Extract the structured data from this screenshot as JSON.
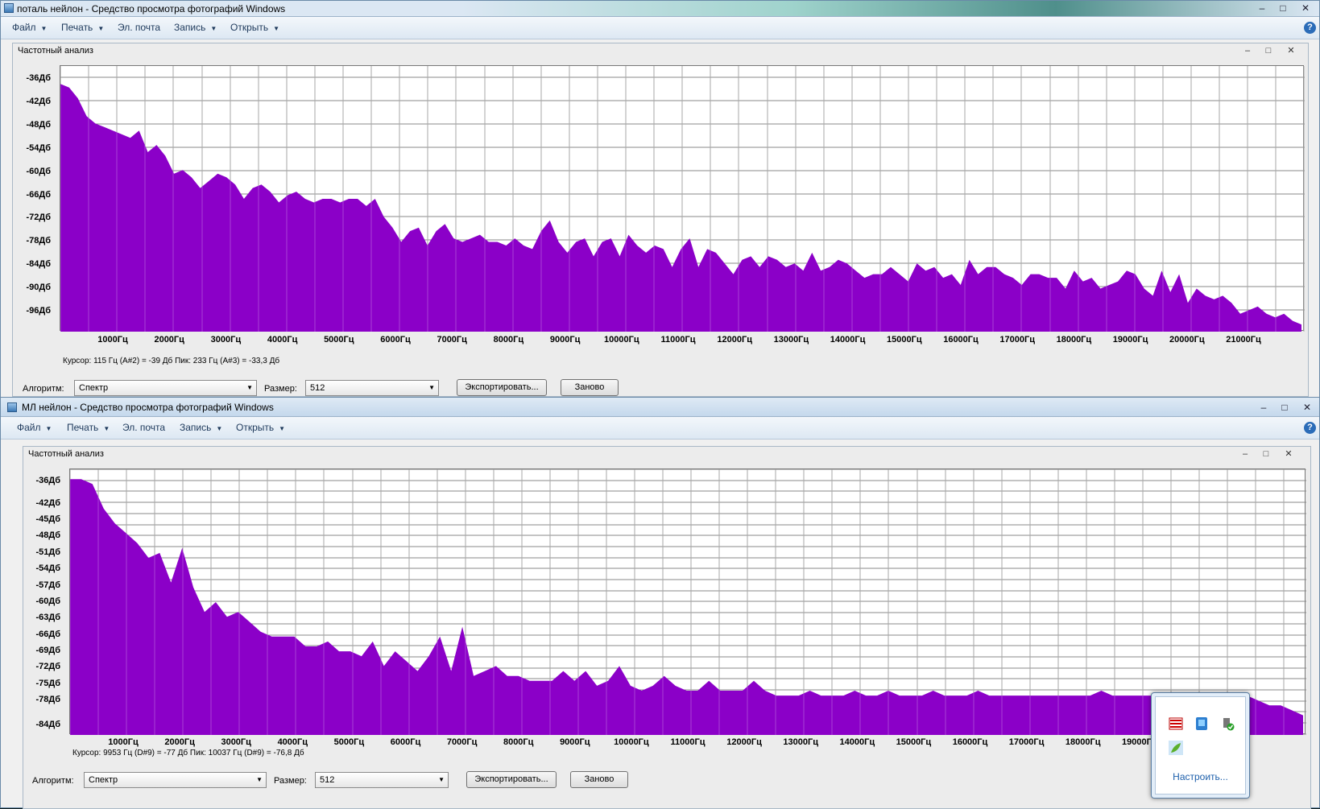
{
  "window1": {
    "title": "поталь нейлон - Средство просмотра фотографий Windows",
    "menu": [
      "Файл",
      "Печать",
      "Эл. почта",
      "Запись",
      "Открыть"
    ],
    "inner_title": "Частотный анализ",
    "ylabels": [
      "-36Дб",
      "-42Дб",
      "-48Дб",
      "-54Дб",
      "-60Дб",
      "-66Дб",
      "-72Дб",
      "-78Дб",
      "-84Дб",
      "-90Дб",
      "-96Дб"
    ],
    "xlabels": [
      "1000Гц",
      "2000Гц",
      "3000Гц",
      "4000Гц",
      "5000Гц",
      "6000Гц",
      "7000Гц",
      "8000Гц",
      "9000Гц",
      "10000Гц",
      "11000Гц",
      "12000Гц",
      "13000Гц",
      "14000Гц",
      "15000Гц",
      "16000Гц",
      "17000Гц",
      "18000Гц",
      "19000Гц",
      "20000Гц",
      "21000Гц"
    ],
    "status": "Курсор: 115 Гц (A#2) = -39 Дб    Пик: 233 Гц (A#3) = -33,3 Дб",
    "algorithm_label": "Алгоритм:",
    "algorithm_value": "Спектр",
    "size_label": "Размер:",
    "size_value": "512",
    "export_button": "Экспортировать...",
    "reset_button": "Заново"
  },
  "window2": {
    "title": "МЛ нейлон - Средство просмотра фотографий Windows",
    "menu": [
      "Файл",
      "Печать",
      "Эл. почта",
      "Запись",
      "Открыть"
    ],
    "inner_title": "Частотный анализ",
    "ylabels": [
      "-36Дб",
      "-42Дб",
      "-45Дб",
      "-48Дб",
      "-51Дб",
      "-54Дб",
      "-57Дб",
      "-60Дб",
      "-63Дб",
      "-66Дб",
      "-69Дб",
      "-72Дб",
      "-75Дб",
      "-78Дб",
      "-84Дб"
    ],
    "xlabels": [
      "1000Гц",
      "2000Гц",
      "3000Гц",
      "4000Гц",
      "5000Гц",
      "6000Гц",
      "7000Гц",
      "8000Гц",
      "9000Гц",
      "10000Гц",
      "11000Гц",
      "12000Гц",
      "13000Гц",
      "14000Гц",
      "15000Гц",
      "16000Гц",
      "17000Гц",
      "18000Гц",
      "19000Гц"
    ],
    "status": "Курсор: 9953 Гц (D#9) = -77 Дб    Пик: 10037 Гц (D#9) = -76,8 Дб",
    "algorithm_label": "Алгоритм:",
    "algorithm_value": "Спектр",
    "size_label": "Размер:",
    "size_value": "512",
    "export_button": "Экспортировать...",
    "reset_button": "Заново"
  },
  "tray": {
    "customize_link": "Настроить...",
    "icons": [
      "flag-icon",
      "network-icon",
      "usb-safe-remove-icon",
      "leaf-icon"
    ]
  },
  "colors": {
    "spectrum_fill": "#8b00c8",
    "grid": "#8a8a8a"
  },
  "spectrum1_db": [
    -35,
    -36,
    -39,
    -44,
    -46,
    -47,
    -48,
    -49,
    -50,
    -48,
    -54,
    -52,
    -55,
    -60,
    -59,
    -61,
    -64,
    -62,
    -60,
    -61,
    -63,
    -67,
    -64,
    -63,
    -65,
    -68,
    -66,
    -65,
    -67,
    -68,
    -67,
    -67,
    -68,
    -67,
    -67,
    -69,
    -67,
    -72,
    -75,
    -79,
    -76,
    -75,
    -80,
    -76,
    -74,
    -78,
    -79,
    -78,
    -77,
    -79,
    -79,
    -80,
    -78,
    -80,
    -81,
    -76,
    -73,
    -79,
    -82,
    -79,
    -78,
    -83,
    -79,
    -78,
    -83,
    -77,
    -80,
    -82,
    -80,
    -81,
    -86,
    -81,
    -78,
    -86,
    -81,
    -82,
    -85,
    -88,
    -84,
    -83,
    -86,
    -83,
    -84,
    -86,
    -85,
    -87,
    -82,
    -87,
    -86,
    -84,
    -85,
    -87,
    -89,
    -88,
    -88,
    -86,
    -88,
    -90,
    -85,
    -87,
    -86,
    -89,
    -88,
    -91,
    -84,
    -88,
    -86,
    -86,
    -88,
    -89,
    -91,
    -88,
    -88,
    -89,
    -89,
    -92,
    -87,
    -90,
    -89,
    -92,
    -91,
    -90,
    -87,
    -88,
    -92,
    -94,
    -87,
    -93,
    -88,
    -96,
    -92,
    -94,
    -95,
    -94,
    -96,
    -99,
    -98,
    -97,
    -99,
    -100,
    -99,
    -101,
    -102
  ],
  "spectrum2_db": [
    -36,
    -36,
    -37,
    -42,
    -45,
    -47,
    -49,
    -52,
    -51,
    -57,
    -50,
    -58,
    -63,
    -61,
    -64,
    -63,
    -65,
    -67,
    -68,
    -68,
    -68,
    -70,
    -70,
    -69,
    -71,
    -71,
    -72,
    -69,
    -74,
    -71,
    -73,
    -75,
    -72,
    -68,
    -75,
    -66,
    -76,
    -75,
    -74,
    -76,
    -76,
    -77,
    -77,
    -77,
    -75,
    -77,
    -75,
    -78,
    -77,
    -74,
    -78,
    -79,
    -78,
    -76,
    -78,
    -79,
    -79,
    -77,
    -79,
    -79,
    -79,
    -77,
    -79,
    -80,
    -80,
    -80,
    -79,
    -80,
    -80,
    -80,
    -79,
    -80,
    -80,
    -79,
    -80,
    -80,
    -80,
    -79,
    -80,
    -80,
    -80,
    -79,
    -80,
    -80,
    -80,
    -80,
    -80,
    -80,
    -80,
    -80,
    -80,
    -80,
    -79,
    -80,
    -80,
    -80,
    -80,
    -80,
    -80,
    -80,
    -80,
    -80,
    -80,
    -80,
    -81,
    -80,
    -81,
    -82,
    -82,
    -83,
    -84
  ]
}
